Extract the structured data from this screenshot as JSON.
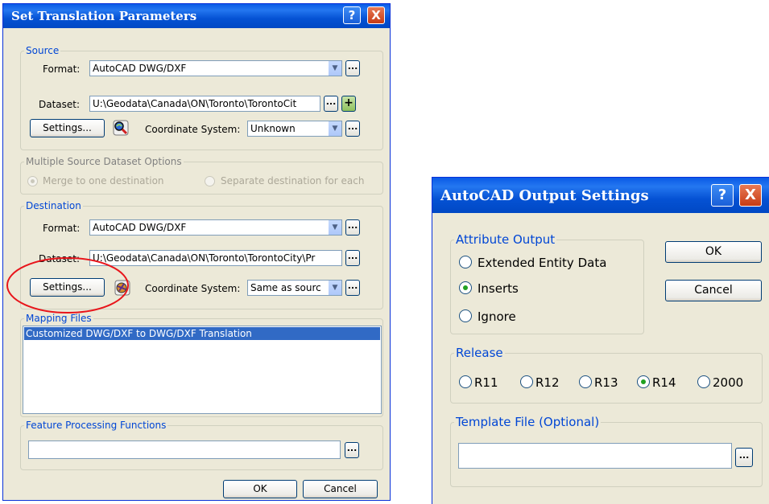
{
  "main_dialog": {
    "title": "Set Translation Parameters",
    "help_glyph": "?",
    "close_glyph": "X",
    "source": {
      "legend": "Source",
      "format_label": "Format:",
      "format_value": "AutoCAD DWG/DXF",
      "dataset_label": "Dataset:",
      "dataset_value": "U:\\Geodata\\Canada\\ON\\Toronto\\TorontoCit",
      "settings_label": "Settings...",
      "coord_label": "Coordinate System:",
      "coord_value": "Unknown"
    },
    "multi_source": {
      "legend": "Multiple Source Dataset Options",
      "option_merge": "Merge to one destination",
      "option_separate": "Separate destination for each"
    },
    "destination": {
      "legend": "Destination",
      "format_label": "Format:",
      "format_value": "AutoCAD DWG/DXF",
      "dataset_label": "Dataset:",
      "dataset_value": "U:\\Geodata\\Canada\\ON\\Toronto\\TorontoCity\\Pr",
      "settings_label": "Settings...",
      "coord_label": "Coordinate System:",
      "coord_value": "Same as sourc"
    },
    "mapping_files": {
      "legend": "Mapping Files",
      "items": [
        "Customized DWG/DXF to DWG/DXF Translation"
      ]
    },
    "feature_processing": {
      "legend": "Feature Processing Functions",
      "value": ""
    },
    "ok_label": "OK",
    "cancel_label": "Cancel"
  },
  "autocad_dialog": {
    "title": "AutoCAD Output Settings",
    "help_glyph": "?",
    "close_glyph": "X",
    "attribute_output": {
      "legend": "Attribute Output",
      "options": [
        "Extended Entity Data",
        "Inserts",
        "Ignore"
      ],
      "selected": "Inserts"
    },
    "release": {
      "legend": "Release",
      "options": [
        "R11",
        "R12",
        "R13",
        "R14",
        "2000"
      ],
      "selected": "R14"
    },
    "template_file": {
      "legend": "Template File (Optional)",
      "value": ""
    },
    "ok_label": "OK",
    "cancel_label": "Cancel"
  },
  "annotation": {
    "color": "#e8151b",
    "target": "destination-settings-button"
  },
  "colors": {
    "titlebar": "#0a5ae6",
    "dialog_bg": "#ece9d8",
    "legend_text": "#0046d5",
    "selection": "#316ac5"
  },
  "icons": {
    "dots_glyph": "...",
    "plus_glyph": "+",
    "arrow_glyph": "▼"
  }
}
